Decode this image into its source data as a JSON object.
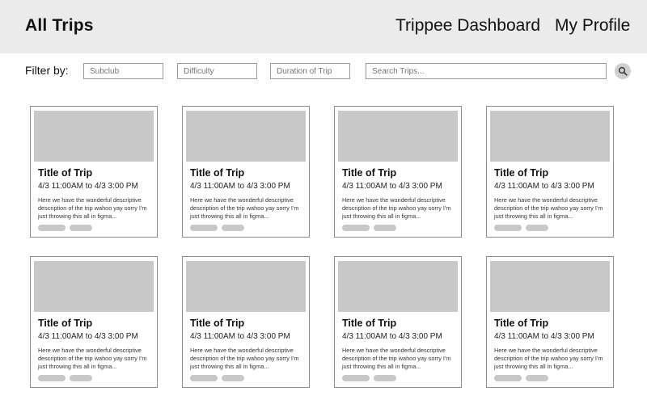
{
  "header": {
    "title": "All Trips",
    "nav": [
      "Trippee Dashboard",
      "My Profile"
    ]
  },
  "filters": {
    "label": "Filter by:",
    "subclub_placeholder": "Subclub",
    "difficulty_placeholder": "Difficulty",
    "duration_placeholder": "Duration of Trip",
    "search_placeholder": "Search Trips..."
  },
  "colors": {
    "header_bg": "#ebebeb",
    "placeholder_gray": "#c8c8c8",
    "card_border": "#8c8c8c"
  },
  "icons": {
    "search": "search-icon"
  },
  "trips": [
    {
      "title": "Title of Trip",
      "time": "4/3  11:00AM to 4/3  3:00 PM",
      "description": "Here we have the wonderful descriptive description of the trip wahoo yay sorry I'm just throwing this all in figma..."
    },
    {
      "title": "Title of Trip",
      "time": "4/3  11:00AM to 4/3  3:00 PM",
      "description": "Here we have the wonderful descriptive description of the trip wahoo yay sorry I'm just throwing this all in figma..."
    },
    {
      "title": "Title of Trip",
      "time": "4/3  11:00AM to 4/3  3:00 PM",
      "description": "Here we have the wonderful descriptive description of the trip wahoo yay sorry I'm just throwing this all in figma..."
    },
    {
      "title": "Title of Trip",
      "time": "4/3  11:00AM to 4/3  3:00 PM",
      "description": "Here we have the wonderful descriptive description of the trip wahoo yay sorry I'm just throwing this all in figma..."
    },
    {
      "title": "Title of Trip",
      "time": "4/3  11:00AM to 4/3  3:00 PM",
      "description": "Here we have the wonderful descriptive description of the trip wahoo yay sorry I'm just throwing this all in figma..."
    },
    {
      "title": "Title of Trip",
      "time": "4/3  11:00AM to 4/3  3:00 PM",
      "description": "Here we have the wonderful descriptive description of the trip wahoo yay sorry I'm just throwing this all in figma..."
    },
    {
      "title": "Title of Trip",
      "time": "4/3  11:00AM to 4/3  3:00 PM",
      "description": "Here we have the wonderful descriptive description of the trip wahoo yay sorry I'm just throwing this all in figma..."
    },
    {
      "title": "Title of Trip",
      "time": "4/3  11:00AM to 4/3  3:00 PM",
      "description": "Here we have the wonderful descriptive description of the trip wahoo yay sorry I'm just throwing this all in figma..."
    }
  ]
}
